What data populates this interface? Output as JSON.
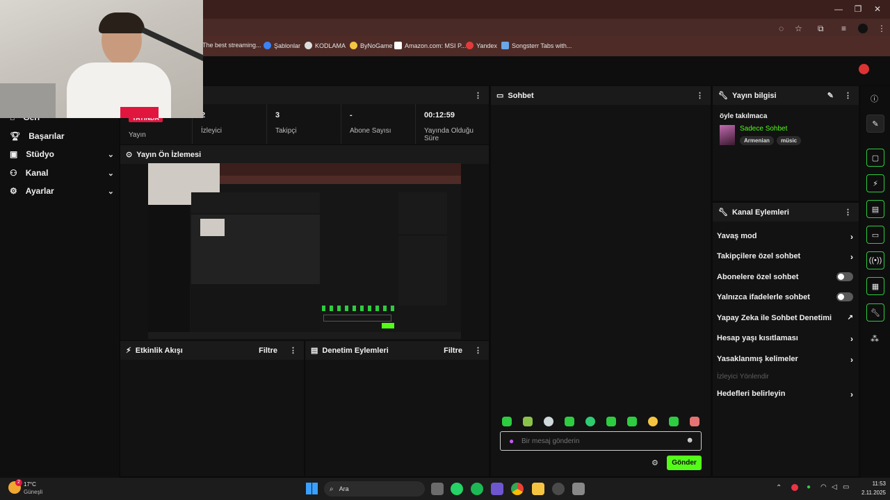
{
  "browser": {
    "bookmarks": [
      "The best streaming...",
      "Şablonlar",
      "KODLAMA",
      "ByNoGame",
      "Amazon.com: MSI P...",
      "Yandex",
      "Songsterr Tabs with..."
    ]
  },
  "sidebar": {
    "items": [
      {
        "label": "Geri",
        "icon": "home-icon"
      },
      {
        "label": "Başarılar",
        "icon": "trophy-icon"
      },
      {
        "label": "Stüdyo",
        "icon": "camera-icon"
      },
      {
        "label": "Kanal",
        "icon": "people-icon"
      },
      {
        "label": "Ayarlar",
        "icon": "gear-icon"
      }
    ]
  },
  "stats": [
    {
      "value": "YAYINDA",
      "label": "Yayın"
    },
    {
      "value": "2",
      "label": "İzleyici"
    },
    {
      "value": "3",
      "label": "Takipçi"
    },
    {
      "value": "-",
      "label": "Abone Sayısı"
    },
    {
      "value": "00:12:59",
      "label": "Yayında Olduğu Süre"
    }
  ],
  "preview": {
    "title": "Yayın Ön İzlemesi"
  },
  "activity": {
    "title": "Etkinlik Akışı",
    "filter": "Filtre"
  },
  "moderation": {
    "title": "Denetim Eylemleri",
    "filter": "Filtre"
  },
  "chat": {
    "title": "Sohbet",
    "placeholder": "Bir mesaj gönderin",
    "send": "Gönder"
  },
  "stream_info": {
    "title": "Yayın bilgisi",
    "stream_title": "öyle takılmaca",
    "mode": "Sadece Sohbet",
    "tags": [
      "Armenian",
      "müsic"
    ]
  },
  "channel_actions": {
    "title": "Kanal Eylemleri",
    "items": [
      {
        "label": "Yavaş mod",
        "type": "chevron"
      },
      {
        "label": "Takipçilere özel sohbet",
        "type": "chevron"
      },
      {
        "label": "Abonelere özel sohbet",
        "type": "toggle"
      },
      {
        "label": "Yalnızca ifadelerle sohbet",
        "type": "toggle"
      },
      {
        "label": "Yapay Zeka ile Sohbet Denetimi",
        "type": "external"
      },
      {
        "label": "Hesap yaşı kısıtlaması",
        "type": "chevron"
      },
      {
        "label": "Yasaklanmış kelimeler",
        "type": "chevron"
      },
      {
        "label": "İzleyici Yönlendir",
        "type": "disabled"
      },
      {
        "label": "Hedefleri belirleyin",
        "type": "chevron"
      }
    ]
  },
  "taskbar": {
    "weather_temp": "17°C",
    "weather_desc": "Güneşli",
    "weather_badge": "2",
    "search": "Ara",
    "time": "11:53",
    "date": "2.11.2025"
  },
  "colors": {
    "accent": "#53fc18",
    "live": "#e0163f",
    "bg": "#0b0b0b"
  }
}
